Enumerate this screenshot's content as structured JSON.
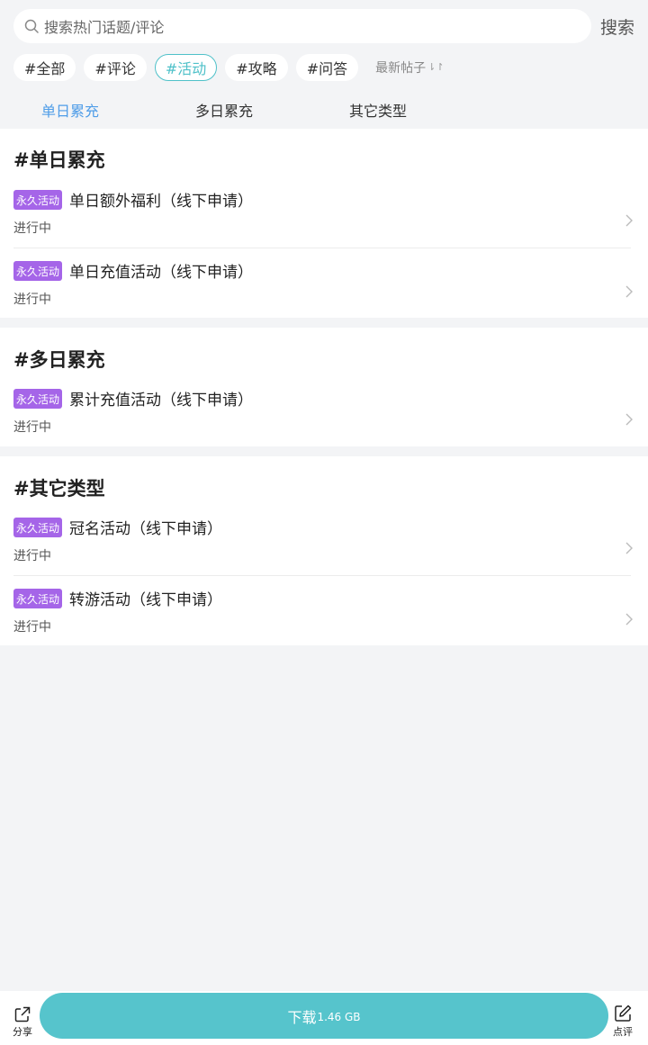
{
  "search": {
    "placeholder": "搜索热门话题/评论",
    "button_label": "搜索"
  },
  "tags": [
    {
      "label": "#全部",
      "active": false
    },
    {
      "label": "#评论",
      "active": false
    },
    {
      "label": "#活动",
      "active": true
    },
    {
      "label": "#攻略",
      "active": false
    },
    {
      "label": "#问答",
      "active": false
    }
  ],
  "sort_label": "最新帖子",
  "tabs": [
    {
      "label": "单日累充",
      "active": true
    },
    {
      "label": "多日累充",
      "active": false
    },
    {
      "label": "其它类型",
      "active": false
    }
  ],
  "sections": [
    {
      "title": "#单日累充",
      "items": [
        {
          "badge": "永久活动",
          "name": "单日额外福利（线下申请）",
          "status": "进行中"
        },
        {
          "badge": "永久活动",
          "name": "单日充值活动（线下申请）",
          "status": "进行中"
        }
      ]
    },
    {
      "title": "#多日累充",
      "items": [
        {
          "badge": "永久活动",
          "name": "累计充值活动（线下申请）",
          "status": "进行中"
        }
      ]
    },
    {
      "title": "#其它类型",
      "items": [
        {
          "badge": "永久活动",
          "name": "冠名活动（线下申请）",
          "status": "进行中"
        },
        {
          "badge": "永久活动",
          "name": "转游活动（线下申请）",
          "status": "进行中"
        }
      ]
    }
  ],
  "bottom": {
    "share_label": "分享",
    "download_label": "下载",
    "download_size": "1.46 GB",
    "review_label": "点评"
  },
  "colors": {
    "accent": "#4fc1c9",
    "tab_active": "#4f9de8",
    "badge": "#a565e8",
    "download_button": "#56c4cc"
  }
}
